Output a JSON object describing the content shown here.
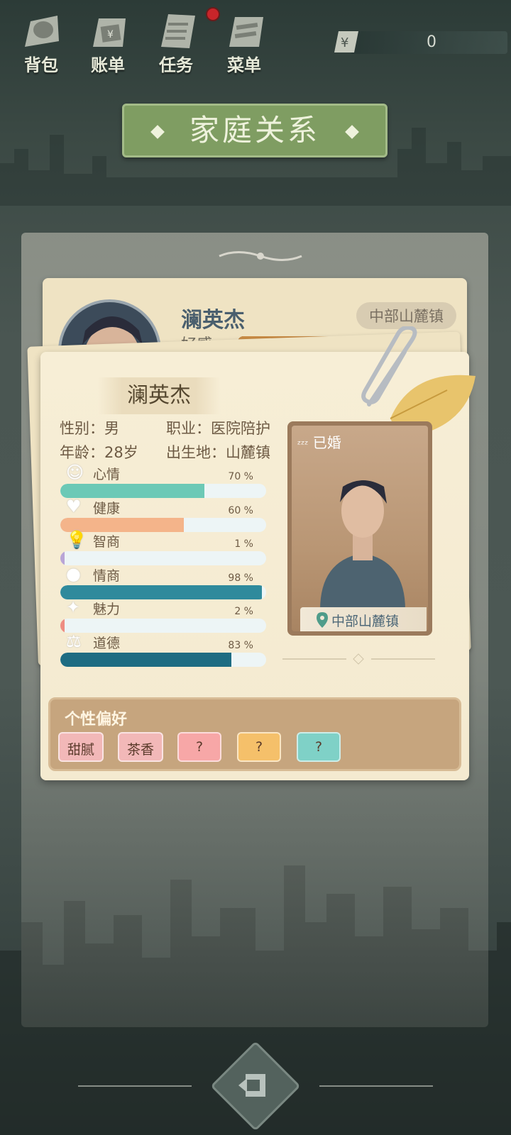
{
  "topbar": {
    "items": [
      {
        "label": "背包",
        "icon": "bag-icon"
      },
      {
        "label": "账单",
        "icon": "bill-icon"
      },
      {
        "label": "任务",
        "icon": "task-icon"
      },
      {
        "label": "菜单",
        "icon": "menu-icon"
      }
    ],
    "currency_symbol": "¥",
    "money": "0"
  },
  "title": "家庭关系",
  "under_card": {
    "name": "澜英杰",
    "affection_label": "好感",
    "affection_level": 0.72,
    "location": "中部山麓镇"
  },
  "profile": {
    "name": "澜英杰",
    "gender": "性别：男",
    "occupation": "职业：医院陪护",
    "age": "年龄：28岁",
    "birthplace": "出生地：山麓镇",
    "stats": [
      {
        "label": "心情",
        "pct": "70 %",
        "value": 70,
        "icon": "smile-icon",
        "color": "#6cc9b6"
      },
      {
        "label": "健康",
        "pct": "60 %",
        "value": 60,
        "icon": "heart-icon",
        "color": "#f4b48a"
      },
      {
        "label": "智商",
        "pct": "1 %",
        "value": 1,
        "icon": "bulb-icon",
        "color": "#b9a5d6"
      },
      {
        "label": "情商",
        "pct": "98 %",
        "value": 98,
        "icon": "apple-icon",
        "color": "#2f8a9c"
      },
      {
        "label": "魅力",
        "pct": "2 %",
        "value": 2,
        "icon": "sparkle-icon",
        "color": "#ee8d82"
      },
      {
        "label": "道德",
        "pct": "83 %",
        "value": 83,
        "icon": "scale-icon",
        "color": "#1e6c82"
      }
    ],
    "status": "已婚",
    "portrait_location": "中部山麓镇"
  },
  "preferences": {
    "title": "个性偏好",
    "items": [
      {
        "label": "甜腻",
        "color": "#f2b8b8"
      },
      {
        "label": "茶香",
        "color": "#f2b8b8"
      },
      {
        "label": "?",
        "color": "#f7a7a7"
      },
      {
        "label": "?",
        "color": "#f5c06a"
      },
      {
        "label": "?",
        "color": "#7fd1c7"
      }
    ]
  },
  "colors": {
    "accent": "#7f9d62",
    "card": "#f4ead0"
  }
}
